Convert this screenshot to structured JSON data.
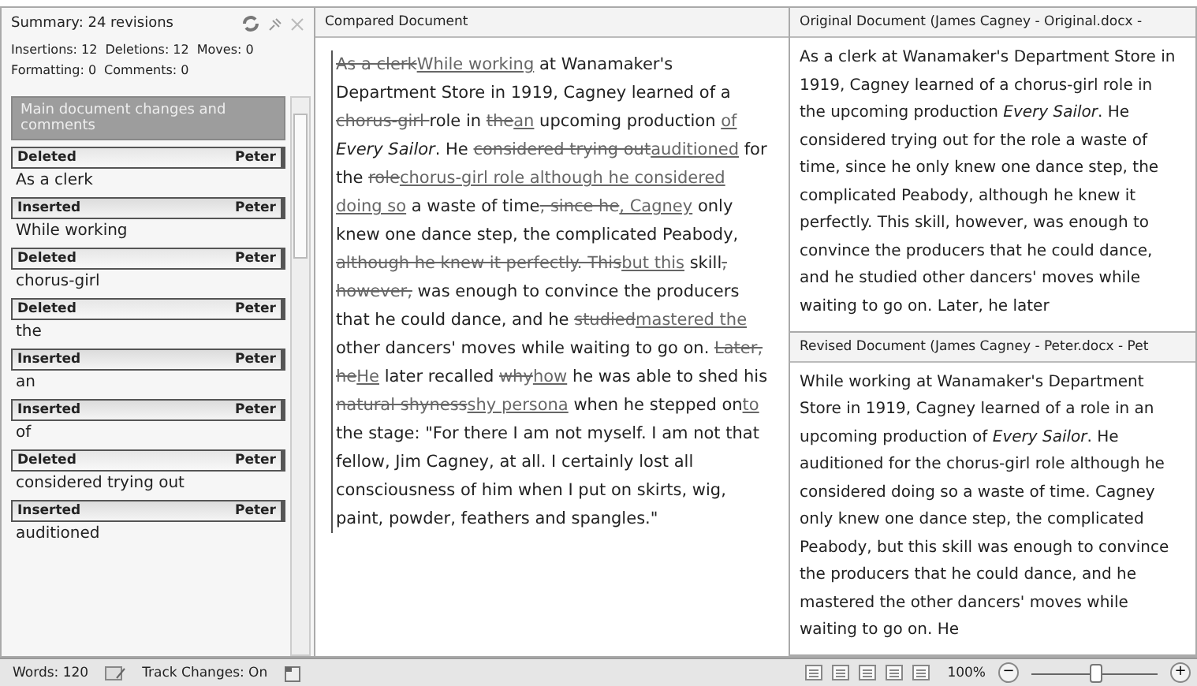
{
  "summary": {
    "title": "Summary: 24 revisions",
    "counts": [
      "Insertions: 12",
      "Deletions: 12",
      "Moves: 0",
      "Formatting: 0",
      "Comments: 0"
    ],
    "group": "Main document changes and comments",
    "revisions": [
      {
        "kind": "deleted",
        "type": "Deleted",
        "author": "Peter",
        "text": "As a clerk"
      },
      {
        "kind": "inserted",
        "type": "Inserted",
        "author": "Peter",
        "text": "While working"
      },
      {
        "kind": "deleted",
        "type": "Deleted",
        "author": "Peter",
        "text": "chorus-girl"
      },
      {
        "kind": "deleted",
        "type": "Deleted",
        "author": "Peter",
        "text": "the"
      },
      {
        "kind": "inserted",
        "type": "Inserted",
        "author": "Peter",
        "text": "an"
      },
      {
        "kind": "inserted",
        "type": "Inserted",
        "author": "Peter",
        "text": "of"
      },
      {
        "kind": "deleted",
        "type": "Deleted",
        "author": "Peter",
        "text": "considered trying out"
      },
      {
        "kind": "inserted",
        "type": "Inserted",
        "author": "Peter",
        "text": "auditioned"
      }
    ]
  },
  "compared": {
    "title": "Compared Document",
    "segments": [
      {
        "kind": "deleted",
        "text": "As a clerk"
      },
      {
        "kind": "inserted",
        "text": "While working"
      },
      {
        "kind": "text",
        "text": " at Wanamaker's Department Store in 1919, Cagney learned of a "
      },
      {
        "kind": "deleted",
        "text": "chorus-girl "
      },
      {
        "kind": "text",
        "text": "role in "
      },
      {
        "kind": "deleted",
        "text": "the"
      },
      {
        "kind": "inserted",
        "text": "an"
      },
      {
        "kind": "text",
        "text": " upcoming production "
      },
      {
        "kind": "inserted",
        "text": "of"
      },
      {
        "kind": "italic",
        "text": " Every Sailor"
      },
      {
        "kind": "text",
        "text": ". He "
      },
      {
        "kind": "deleted",
        "text": "considered trying out"
      },
      {
        "kind": "inserted",
        "text": "auditioned"
      },
      {
        "kind": "text",
        "text": " for the "
      },
      {
        "kind": "deleted",
        "text": "role"
      },
      {
        "kind": "inserted",
        "text": "chorus-girl role although he considered doing so"
      },
      {
        "kind": "text",
        "text": " a waste of time"
      },
      {
        "kind": "deleted",
        "text": ", since he"
      },
      {
        "kind": "inserted",
        "text": ", Cagney"
      },
      {
        "kind": "text",
        "text": " only knew one dance step, the complicated Peabody, "
      },
      {
        "kind": "deleted",
        "text": "although he knew it perfectly. This"
      },
      {
        "kind": "inserted",
        "text": "but this"
      },
      {
        "kind": "text",
        "text": " skill"
      },
      {
        "kind": "deleted",
        "text": ", however,"
      },
      {
        "kind": "text",
        "text": " was enough to convince the producers that he could dance, and he "
      },
      {
        "kind": "deleted",
        "text": "studied"
      },
      {
        "kind": "inserted",
        "text": "mastered the"
      },
      {
        "kind": "text",
        "text": " other dancers' moves while waiting to go on. "
      },
      {
        "kind": "deleted",
        "text": "Later, he"
      },
      {
        "kind": "inserted",
        "text": "He"
      },
      {
        "kind": "text",
        "text": " later recalled "
      },
      {
        "kind": "deleted",
        "text": "why"
      },
      {
        "kind": "inserted",
        "text": "how"
      },
      {
        "kind": "text",
        "text": " he was able to shed his "
      },
      {
        "kind": "deleted",
        "text": "natural shyness"
      },
      {
        "kind": "inserted",
        "text": "shy persona"
      },
      {
        "kind": "text",
        "text": " when he stepped on"
      },
      {
        "kind": "inserted",
        "text": "to"
      },
      {
        "kind": "text",
        "text": " the stage: \"For there I am not myself. I am not that fellow, Jim Cagney, at all. I certainly lost all consciousness of him when I put on skirts, wig, paint, powder, feathers and spangles.\""
      }
    ]
  },
  "original": {
    "title": "Original Document (James Cagney - Original.docx -",
    "text": "As a clerk at Wanamaker's Department Store in 1919, Cagney learned of a chorus-girl role in the upcoming production *Every Sailor*. He considered trying out for the role a waste of time, since he only knew one dance step, the complicated Peabody, although he knew it perfectly. This skill, however, was enough to convince the producers that he could dance, and he studied other dancers' moves while waiting to go on. Later, he later"
  },
  "revised": {
    "title": "Revised Document (James Cagney - Peter.docx - Pet",
    "text": "While working at Wanamaker's Department Store in 1919, Cagney learned of a role in an upcoming production of *Every Sailor*. He auditioned for the chorus-girl role although he considered doing so a waste of time. Cagney only knew one dance step, the complicated Peabody, but this skill was enough to convince the producers that he could dance, and he mastered the other dancers' moves while waiting to go on. He"
  },
  "status_bar": {
    "words": "Words: 120",
    "track_changes": "Track Changes: On",
    "zoom": "100%",
    "zoom_level": {
      "level": 0.5
    },
    "minus": "−",
    "plus": "+"
  }
}
